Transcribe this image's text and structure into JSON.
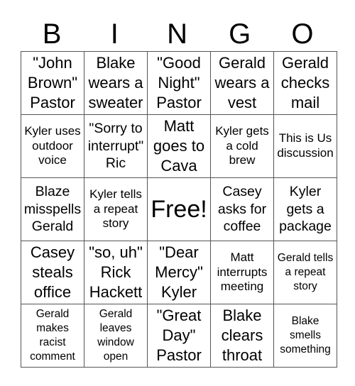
{
  "header": {
    "letters": [
      "B",
      "I",
      "N",
      "G",
      "O"
    ]
  },
  "grid": {
    "rows": [
      [
        "\"John Brown\" Pastor",
        "Blake wears a sweater",
        "\"Good Night\" Pastor",
        "Gerald wears a vest",
        "Gerald checks mail"
      ],
      [
        "Kyler uses outdoor voice",
        "\"Sorry to interrupt\" Ric",
        "Matt goes to Cava",
        "Kyler gets a cold brew",
        "This is Us discussion"
      ],
      [
        "Blaze misspells Gerald",
        "Kyler tells a repeat story",
        "Free!",
        "Casey asks for coffee",
        "Kyler gets a package"
      ],
      [
        "Casey steals office",
        "\"so, uh\" Rick Hackett",
        "\"Dear Mercy\" Kyler",
        "Matt interrupts meeting",
        "Gerald tells a repeat story"
      ],
      [
        "Gerald makes racist comment",
        "Gerald leaves window open",
        "\"Great Day\" Pastor",
        "Blake clears throat",
        "Blake smells something"
      ]
    ]
  }
}
